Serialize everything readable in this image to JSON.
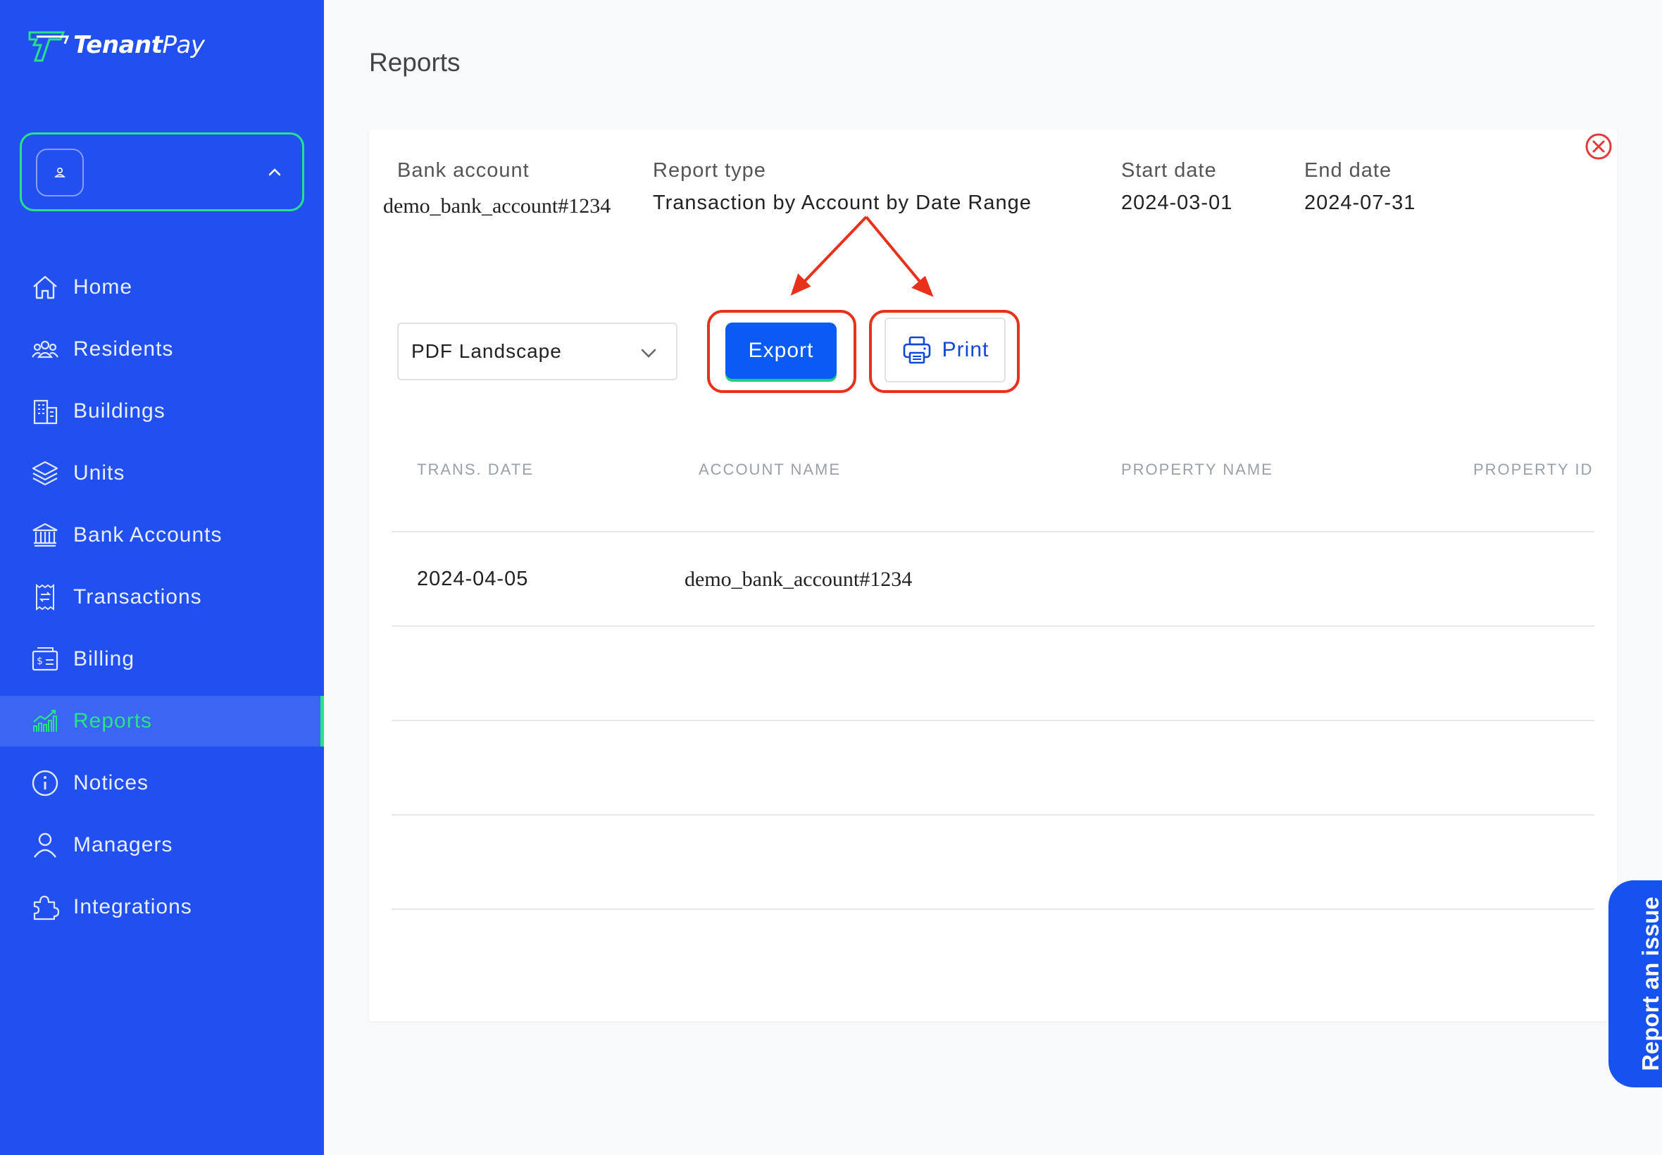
{
  "app": {
    "brand_bold": "Tenant",
    "brand_light": "Pay"
  },
  "sidebar": {
    "items": [
      {
        "label": "Home",
        "icon": "home-icon"
      },
      {
        "label": "Residents",
        "icon": "residents-icon"
      },
      {
        "label": "Buildings",
        "icon": "buildings-icon"
      },
      {
        "label": "Units",
        "icon": "units-icon"
      },
      {
        "label": "Bank Accounts",
        "icon": "bank-icon"
      },
      {
        "label": "Transactions",
        "icon": "transactions-icon"
      },
      {
        "label": "Billing",
        "icon": "billing-icon"
      },
      {
        "label": "Reports",
        "icon": "reports-icon",
        "active": true
      },
      {
        "label": "Notices",
        "icon": "info-icon"
      },
      {
        "label": "Managers",
        "icon": "user-icon"
      },
      {
        "label": "Integrations",
        "icon": "puzzle-icon"
      }
    ]
  },
  "page": {
    "title": "Reports"
  },
  "report": {
    "bank_account_label": "Bank account",
    "bank_account_value": "demo_bank_account#1234",
    "report_type_label": "Report type",
    "report_type_value": "Transaction by Account by Date Range",
    "start_date_label": "Start date",
    "start_date_value": "2024-03-01",
    "end_date_label": "End date",
    "end_date_value": "2024-07-31"
  },
  "controls": {
    "format_selected": "PDF Landscape",
    "export_label": "Export",
    "print_label": "Print"
  },
  "table": {
    "headers": [
      "TRANS. DATE",
      "ACCOUNT NAME",
      "PROPERTY NAME",
      "PROPERTY ID"
    ],
    "rows": [
      {
        "trans_date": "2024-04-05",
        "account_name": "demo_bank_account#1234",
        "property_name": "",
        "property_id": ""
      }
    ]
  },
  "feedback": {
    "label": "Report an issue"
  },
  "colors": {
    "sidebar_bg": "#2150ee",
    "accent_green": "#2be08a",
    "primary_button": "#0a5af5",
    "annotation_red": "#e8311a"
  }
}
